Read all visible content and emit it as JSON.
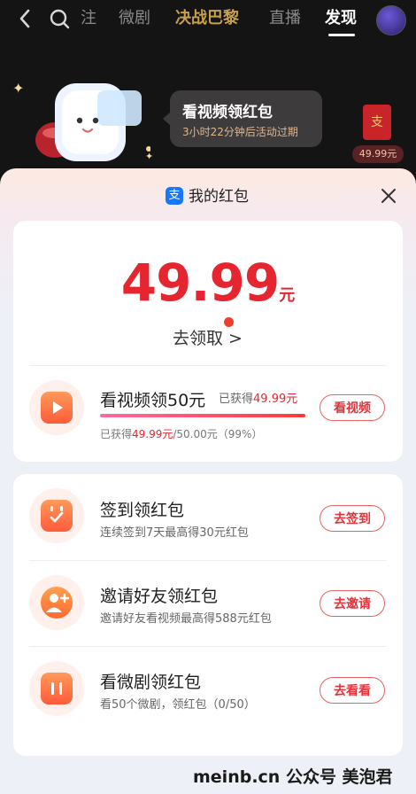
{
  "nav": {
    "tabs": [
      {
        "label": "注",
        "active": false
      },
      {
        "label": "微剧",
        "active": false
      },
      {
        "label": "决战巴黎",
        "active": false
      },
      {
        "label": "直播",
        "active": false
      },
      {
        "label": "发现",
        "active": true
      }
    ]
  },
  "promo": {
    "title": "看视频领红包",
    "subtitle": "3小时22分钟后活动过期",
    "mini_icon": "支",
    "mini_amount": "49.99元"
  },
  "sheet": {
    "title": "我的红包",
    "alipay_glyph": "支",
    "balance": "49.99",
    "balance_unit": "元",
    "claim_label": "去领取 >"
  },
  "video_task": {
    "title": "看视频领50元",
    "earned_prefix": "已获得",
    "earned_value": "49.99元",
    "button": "看视频",
    "progress_fraction": 0.9998,
    "progress_prefix": "已获得",
    "progress_value": "49.99元",
    "progress_suffix": "/50.00元（99%）"
  },
  "tasks": [
    {
      "title": "签到领红包",
      "desc": "连续签到7天最高得30元红包",
      "button": "去签到",
      "icon": "calendar-check-icon"
    },
    {
      "title": "邀请好友领红包",
      "desc": "邀请好友看视频最高得588元红包",
      "button": "去邀请",
      "icon": "add-user-icon"
    },
    {
      "title": "看微剧领红包",
      "desc": "看50个微剧，领红包（0/50）",
      "button": "去看看",
      "icon": "short-drama-icon"
    }
  ],
  "watermark": "meinb.cn 公众号 美泡君",
  "colors": {
    "accent_red": "#e5252f",
    "sheet_top": "#fde9e2",
    "icon_orange": "#ff5b39"
  }
}
